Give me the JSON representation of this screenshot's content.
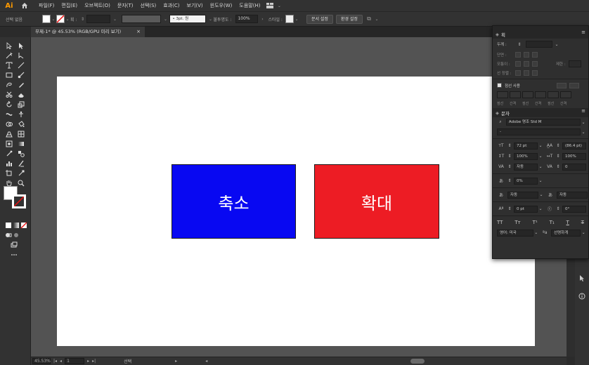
{
  "app": {
    "logo": "Ai",
    "menus": [
      "파일(F)",
      "편집(E)",
      "오브젝트(O)",
      "문자(T)",
      "선택(S)",
      "효과(C)",
      "보기(V)",
      "윈도우(W)",
      "도움말(H)"
    ]
  },
  "control": {
    "selection_label": "선택 없음",
    "stroke_label": "획 :",
    "brush_value": "• 3pt. 원",
    "opacity_label": "불투명도 :",
    "opacity_value": "100%",
    "style_label": "스타일 :",
    "doc_setup_button": "문서 설정",
    "preferences_button": "환경 설정"
  },
  "document": {
    "tab_title": "무제-1* @ 45.53% (RGB/GPU 미리 보기)",
    "close": "×"
  },
  "artboard": {
    "shrink_label": "축소",
    "enlarge_label": "확대",
    "colors": {
      "shrink": "#0808f2",
      "enlarge": "#ed1c24"
    }
  },
  "status": {
    "zoom": "45.53%",
    "page": "1",
    "tool_text": "선택"
  },
  "stroke_panel": {
    "title": "획",
    "weight_label": "두께 :",
    "cap_label": "단면 :",
    "corner_label": "모퉁이 :",
    "limit_label": "제한 :",
    "align_label": "선 정렬 :",
    "dashed_label": "점선 사용",
    "dash_labels": [
      "점선",
      "간격",
      "점선",
      "간격",
      "점선",
      "간격"
    ]
  },
  "character_panel": {
    "title": "문자",
    "font_family": "Adobe 명조 Std M",
    "font_style": "-",
    "font_size": "72 pt",
    "leading": "(86.4 pt)",
    "vscale": "100%",
    "hscale": "100%",
    "kerning": "자동",
    "tracking": "0",
    "tsume": "0%",
    "aki_left": "자동",
    "aki_right": "자동",
    "baseline": "0 pt",
    "rotation": "0°",
    "language": "영어: 미국",
    "antialias": "선명하게"
  }
}
